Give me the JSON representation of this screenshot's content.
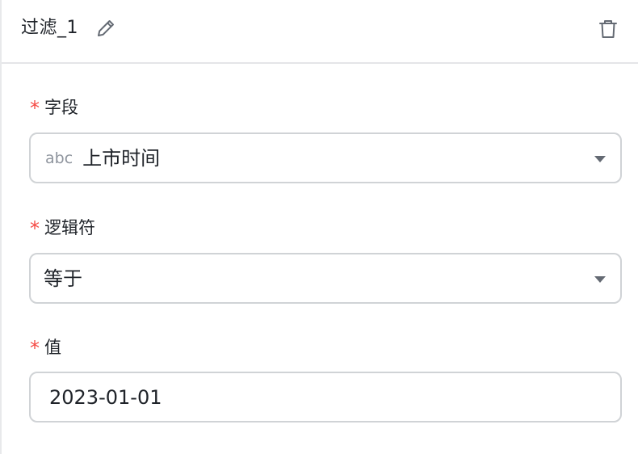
{
  "header": {
    "title": "过滤_1",
    "edit_icon": "pencil-icon",
    "delete_icon": "trash-icon"
  },
  "fields": {
    "field": {
      "required_mark": "*",
      "label": "字段",
      "type_tag": "abc",
      "value": "上市时间"
    },
    "operator": {
      "required_mark": "*",
      "label": "逻辑符",
      "value": "等于"
    },
    "value": {
      "required_mark": "*",
      "label": "值",
      "value": "2023-01-01"
    }
  },
  "colors": {
    "required": "#f54a45",
    "border": "#d0d3d6",
    "text": "#1f2329",
    "muted": "#8f959e"
  }
}
